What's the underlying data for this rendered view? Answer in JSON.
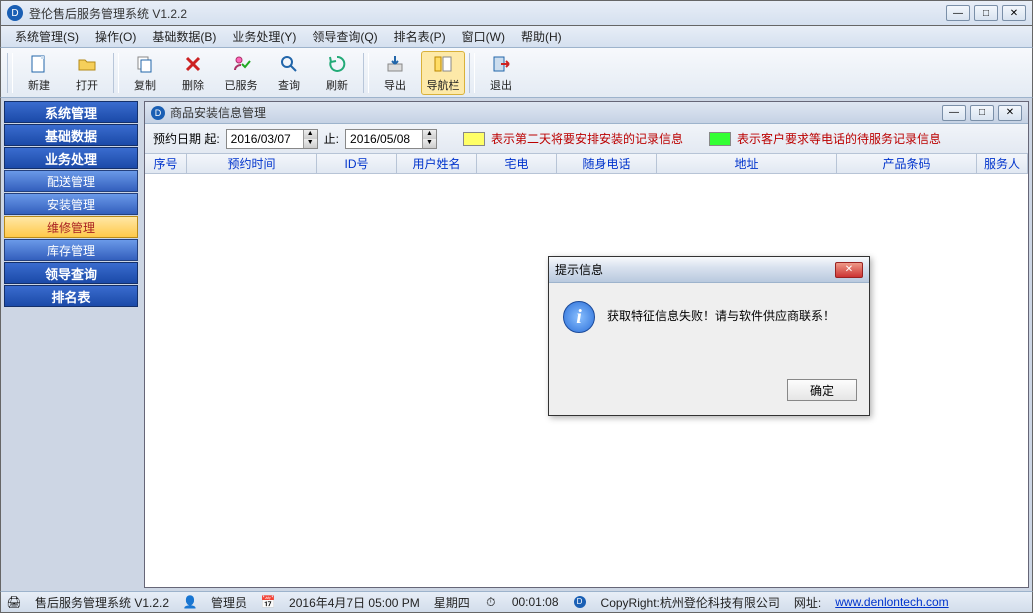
{
  "app": {
    "title": "登伦售后服务管理系统 V1.2.2",
    "icon_letter": "D"
  },
  "menu": {
    "system": "系统管理(S)",
    "operate": "操作(O)",
    "base": "基础数据(B)",
    "business": "业务处理(Y)",
    "leader": "领导查询(Q)",
    "rank": "排名表(P)",
    "window": "窗口(W)",
    "help": "帮助(H)"
  },
  "toolbar": {
    "new": "新建",
    "open": "打开",
    "copy": "复制",
    "delete": "删除",
    "served": "已服务",
    "query": "查询",
    "refresh": "刷新",
    "export": "导出",
    "nav": "导航栏",
    "exit": "退出"
  },
  "sidebar": {
    "groups": {
      "system": "系统管理",
      "base": "基础数据",
      "business": "业务处理",
      "leader": "领导查询",
      "rank": "排名表"
    },
    "items": {
      "delivery": "配送管理",
      "install": "安装管理",
      "repair": "维修管理",
      "stock": "库存管理"
    }
  },
  "inner": {
    "title": "商品安装信息管理",
    "filter": {
      "label_from": "预约日期 起:",
      "date_from": "2016/03/07",
      "label_to": "止:",
      "date_to": "2016/05/08",
      "legend1": "表示第二天将要安排安装的记录信息",
      "legend2": "表示客户要求等电话的待服务记录信息",
      "swatch1": "#ffff66",
      "swatch2": "#33ff33"
    },
    "columns": {
      "seq": "序号",
      "time": "预约时间",
      "id": "ID号",
      "user": "用户姓名",
      "homephone": "宅电",
      "mobile": "随身电话",
      "address": "地址",
      "barcode": "产品条码",
      "staff": "服务人"
    }
  },
  "dialog": {
    "title": "提示信息",
    "message": "获取特征信息失败！请与软件供应商联系！",
    "ok": "确定"
  },
  "status": {
    "app": "售后服务管理系统 V1.2.2",
    "user": "管理员",
    "datetime": "2016年4月7日 05:00 PM",
    "weekday": "星期四",
    "elapsed": "00:01:08",
    "copyright": "CopyRight:杭州登伦科技有限公司",
    "url_label": "网址:",
    "url": "www.denlontech.com"
  }
}
